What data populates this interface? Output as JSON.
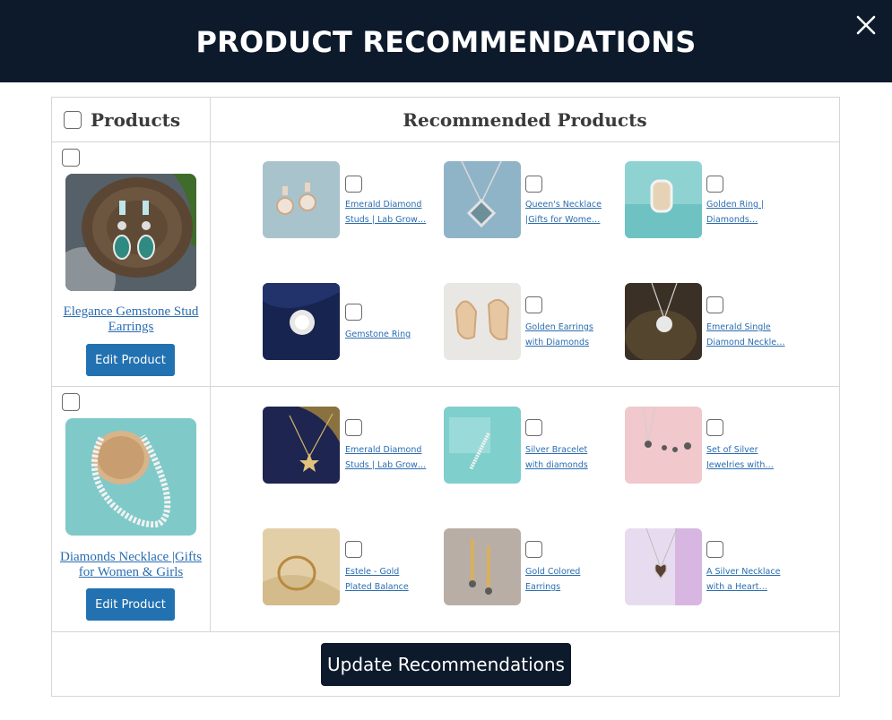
{
  "header": {
    "title": "PRODUCT RECOMMENDATIONS"
  },
  "table": {
    "col_products": "Products",
    "col_recommended": "Recommended Products"
  },
  "rows": [
    {
      "product_name": "Elegance Gemstone Stud Earrings",
      "edit_label": "Edit Product",
      "recommendations": [
        {
          "name": "Emerald Diamond Studs | Lab Grow…",
          "icon": "stud-earrings"
        },
        {
          "name": "Queen's Necklace |Gifts for Wome…",
          "icon": "pendant-necklace"
        },
        {
          "name": "Golden Ring | Diamonds…",
          "icon": "ring"
        },
        {
          "name": "Gemstone Ring",
          "icon": "cluster-ring"
        },
        {
          "name": "Golden Earrings with Diamonds",
          "icon": "hoop-earrings"
        },
        {
          "name": "Emerald Single Diamond Neckle…",
          "icon": "diamond-pendant"
        }
      ]
    },
    {
      "product_name": "Diamonds Necklace |Gifts for Women & Girls",
      "edit_label": "Edit Product",
      "recommendations": [
        {
          "name": "Emerald Diamond Studs | Lab Grow…",
          "icon": "star-pendant"
        },
        {
          "name": "Silver Bracelet with diamonds",
          "icon": "tennis-bracelet"
        },
        {
          "name": "Set of Silver Jewelries with…",
          "icon": "jewelry-set"
        },
        {
          "name": "Estele - Gold Plated Balance Cuff…",
          "icon": "cuff-bracelet"
        },
        {
          "name": "Gold Colored Earrings",
          "icon": "drop-earrings"
        },
        {
          "name": "A Silver Necklace with a Heart…",
          "icon": "heart-necklace"
        }
      ]
    }
  ],
  "footer": {
    "update_label": "Update Recommendations"
  },
  "colors": {
    "header_bg": "#0d1a2b",
    "accent": "#2271b1",
    "link": "#2a6db0"
  }
}
